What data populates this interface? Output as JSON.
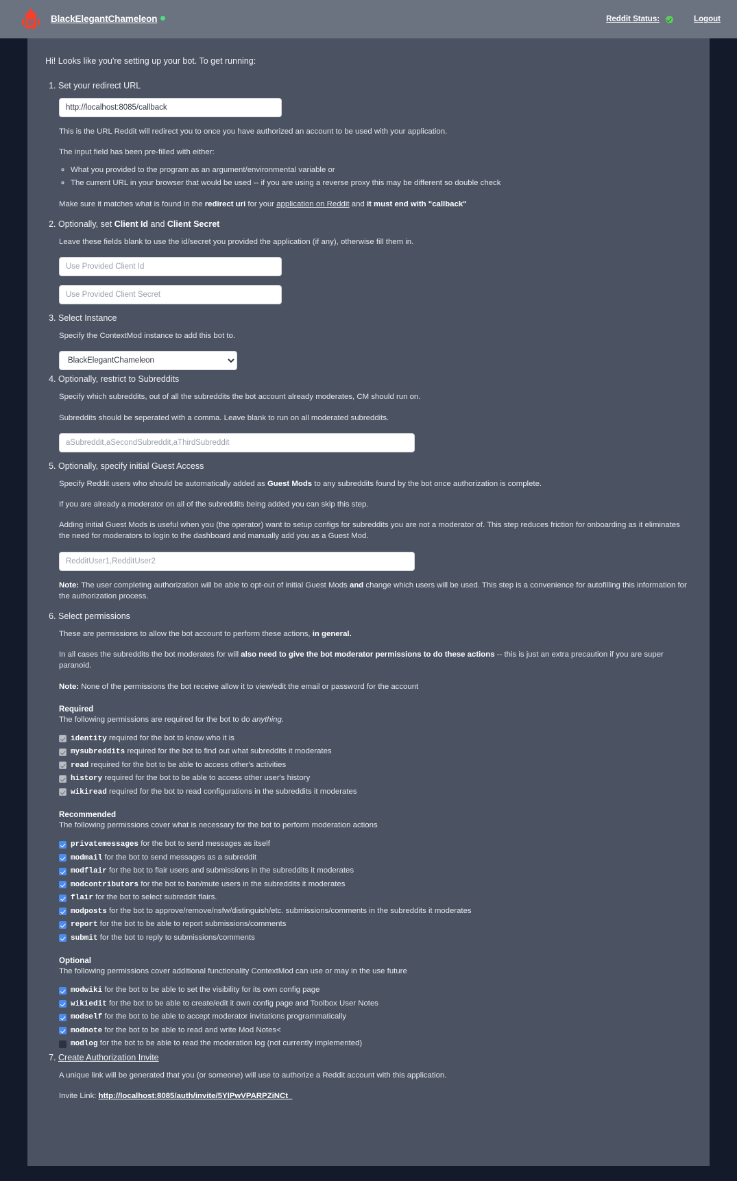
{
  "header": {
    "logo_icon": "robot-cm-logo-icon",
    "brand_name": "BlackElegantChameleon",
    "brand_status_icon": "online-dot-icon",
    "reddit_status_label": "Reddit Status:",
    "reddit_status_icon": "green-check-circle-icon",
    "logout_label": "Logout"
  },
  "intro": "Hi! Looks like you're setting up your bot. To get running:",
  "steps": {
    "step1": {
      "title": "Set your redirect URL",
      "input_value": "http://localhost:8085/callback",
      "desc1": "This is the URL Reddit will redirect you to once you have authorized an account to be used with your application.",
      "desc2": "The input field has been pre-filled with either:",
      "bullet1": "What you provided to the program as an argument/environmental variable or",
      "bullet2": "The current URL in your browser that would be used -- if you are using a reverse proxy this may be different so double check",
      "match_prefix": "Make sure it matches what is found in the ",
      "match_bold1": "redirect uri",
      "match_mid": " for your ",
      "match_link": "application on Reddit",
      "match_mid2": " and ",
      "match_bold2": "it must end with \"callback\""
    },
    "step2": {
      "title_prefix": "Optionally, set ",
      "title_bold1": "Client Id",
      "title_mid": " and ",
      "title_bold2": "Client Secret",
      "desc": "Leave these fields blank to use the id/secret you provided the application (if any), otherwise fill them in.",
      "client_id_placeholder": "Use Provided Client Id",
      "client_secret_placeholder": "Use Provided Client Secret"
    },
    "step3": {
      "title": "Select Instance",
      "desc": "Specify the ContextMod instance to add this bot to.",
      "selected": "BlackElegantChameleon",
      "options": [
        "BlackElegantChameleon"
      ]
    },
    "step4": {
      "title": "Optionally, restrict to Subreddits",
      "desc1": "Specify which subreddits, out of all the subreddits the bot account already moderates, CM should run on.",
      "desc2": "Subreddits should be seperated with a comma. Leave blank to run on all moderated subreddits.",
      "placeholder": "aSubreddit,aSecondSubreddit,aThirdSubreddit"
    },
    "step5": {
      "title": "Optionally, specify initial Guest Access",
      "desc1_pre": "Specify Reddit users who should be automatically added as ",
      "desc1_bold": "Guest Mods",
      "desc1_post": " to any subreddits found by the bot once authorization is complete.",
      "desc2": "If you are already a moderator on all of the subreddits being added you can skip this step.",
      "desc3": "Adding initial Guest Mods is useful when you (the operator) want to setup configs for subreddits you are not a moderator of. This step reduces friction for onboarding as it eliminates the need for moderators to login to the dashboard and manually add you as a Guest Mod.",
      "placeholder": "RedditUser1,RedditUser2",
      "note_label": "Note:",
      "note_pre": " The user completing authorization will be able to opt-out of initial Guest Mods ",
      "note_bold": "and",
      "note_post": " change which users will be used. This step is a convenience for autofilling this information for the authorization process."
    },
    "step6": {
      "title": "Select permissions",
      "desc1_pre": "These are permissions to allow the bot account to perform these actions, ",
      "desc1_bold": "in general.",
      "desc2_pre": "In all cases the subreddits the bot moderates for will ",
      "desc2_bold": "also need to give the bot moderator permissions to do these actions",
      "desc2_post": " -- this is just an extra precaution if you are super paranoid.",
      "note_label": "Note:",
      "note_text": " None of the permissions the bot receive allow it to view/edit the email or password for the account",
      "required": {
        "heading": "Required",
        "sub_pre": "The following permissions are required for the bot to do ",
        "sub_em": "anything.",
        "items": [
          {
            "scope": "identity",
            "desc": "required for the bot to know who it is",
            "state": "locked"
          },
          {
            "scope": "mysubreddits",
            "desc": "required for the bot to find out what subreddits it moderates",
            "state": "locked"
          },
          {
            "scope": "read",
            "desc": "required for the bot to be able to access other's activities",
            "state": "locked"
          },
          {
            "scope": "history",
            "desc": "required for the bot to be able to access other user's history",
            "state": "locked"
          },
          {
            "scope": "wikiread",
            "desc": "required for the bot to read configurations in the subreddits it moderates",
            "state": "locked"
          }
        ]
      },
      "recommended": {
        "heading": "Recommended",
        "sub": "The following permissions cover what is necessary for the bot to perform moderation actions",
        "items": [
          {
            "scope": "privatemessages",
            "desc": "for the bot to send messages as itself",
            "state": "on"
          },
          {
            "scope": "modmail",
            "desc": "for the bot to send messages as a subreddit",
            "state": "on"
          },
          {
            "scope": "modflair",
            "desc": "for the bot to flair users and submissions in the subreddits it moderates",
            "state": "on"
          },
          {
            "scope": "modcontributors",
            "desc": "for the bot to ban/mute users in the subreddits it moderates",
            "state": "on"
          },
          {
            "scope": "flair",
            "desc": "for the bot to select subreddit flairs.",
            "state": "on"
          },
          {
            "scope": "modposts",
            "desc": "for the bot to approve/remove/nsfw/distinguish/etc. submissions/comments in the subreddits it moderates",
            "state": "on"
          },
          {
            "scope": "report",
            "desc": "for the bot to be able to report submissions/comments",
            "state": "on"
          },
          {
            "scope": "submit",
            "desc": "for the bot to reply to submissions/comments",
            "state": "on"
          }
        ]
      },
      "optional": {
        "heading": "Optional",
        "sub": "The following permissions cover additional functionality ContextMod can use or may in the use future",
        "items": [
          {
            "scope": "modwiki",
            "desc": "for the bot to be able to set the visibility for its own config page",
            "state": "on"
          },
          {
            "scope": "wikiedit",
            "desc": "for the bot to be able to create/edit it own config page and Toolbox User Notes",
            "state": "on"
          },
          {
            "scope": "modself",
            "desc": "for the bot to be able to accept moderator invitations programmatically",
            "state": "on"
          },
          {
            "scope": "modnote",
            "desc": "for the bot to be able to read and write Mod Notes<",
            "state": "on"
          },
          {
            "scope": "modlog",
            "desc": "for the bot to be able to read the moderation log (not currently implemented)",
            "state": "off"
          }
        ]
      }
    },
    "step7": {
      "title": "Create Authorization Invite",
      "desc": "A unique link will be generated that you (or someone) will use to authorize a Reddit account with this application.",
      "invite_label": "Invite Link:",
      "invite_url": "http://localhost:8085/auth/invite/5YlPwVPARPZiNCt_"
    }
  },
  "colors": {
    "page_background": "#131a2a",
    "card_background": "#4b5363",
    "navbar_background": "#6b7280",
    "logo_red": "#f4402d",
    "checkbox_blue": "#4a8cf0",
    "status_green": "#4ade80"
  }
}
